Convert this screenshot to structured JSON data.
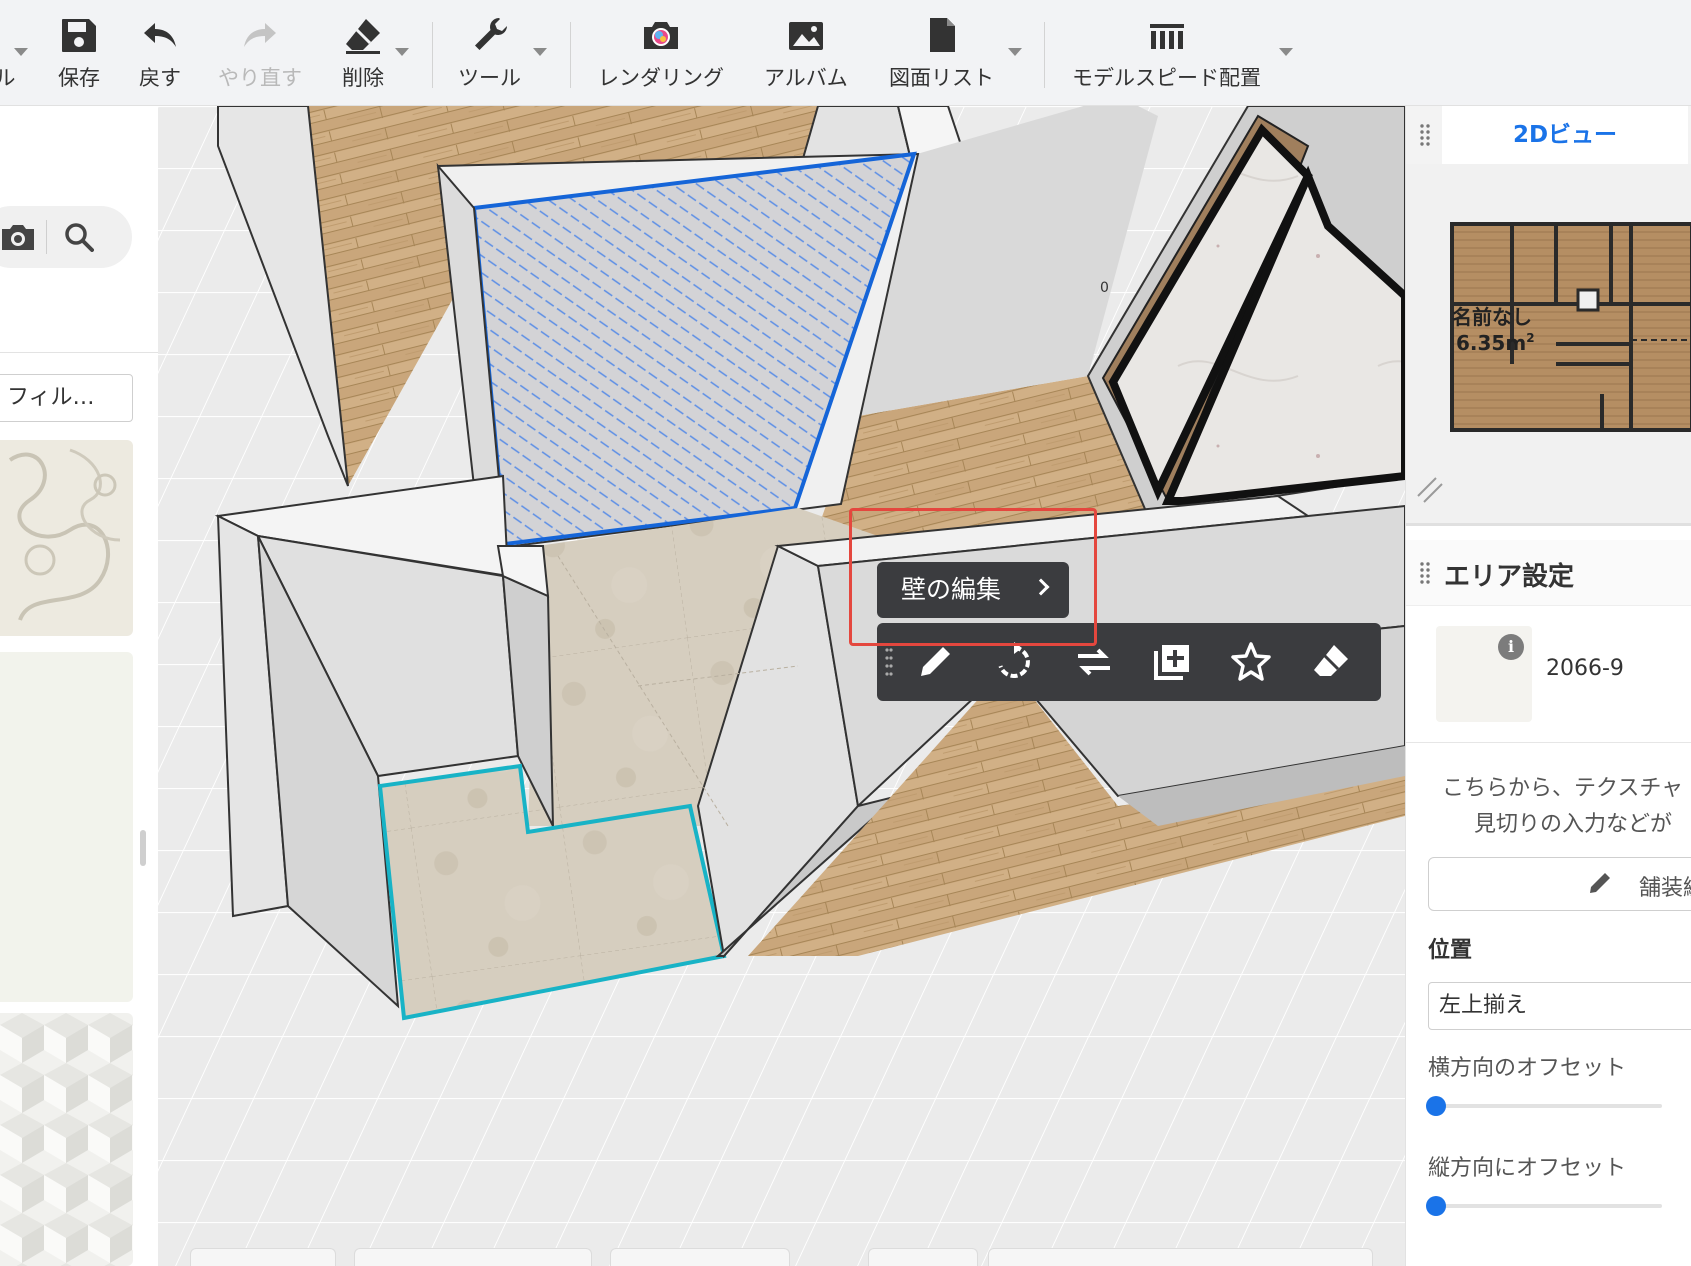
{
  "toolbar": {
    "items": [
      {
        "label": "ル",
        "icon": "file-icon"
      },
      {
        "label": "保存",
        "icon": "save-icon"
      },
      {
        "label": "戻す",
        "icon": "undo-icon"
      },
      {
        "label": "やり直す",
        "icon": "redo-icon",
        "disabled": true
      },
      {
        "label": "削除",
        "icon": "eraser-icon"
      },
      {
        "label": "ツール",
        "icon": "wrench-icon"
      },
      {
        "label": "レンダリング",
        "icon": "camera-icon"
      },
      {
        "label": "アルバム",
        "icon": "album-icon"
      },
      {
        "label": "図面リスト",
        "icon": "drawing-list-icon"
      },
      {
        "label": "モデルスピード配置",
        "icon": "model-speed-icon"
      }
    ]
  },
  "left_panel": {
    "filter_label": "フィル…",
    "icons": [
      "camera-search-icon",
      "search-icon"
    ]
  },
  "viewport": {
    "wall_edit_label": "壁の編集",
    "context_toolbar": [
      "edit-icon",
      "rotate-icon",
      "flip-icon",
      "duplicate-icon",
      "favorite-icon",
      "erase-icon"
    ]
  },
  "right_panel": {
    "tab_2d": "2Dビュー",
    "minimap": {
      "room_name": "名前なし",
      "room_area": "6.35m",
      "area_sup": "2"
    },
    "area_settings_title": "エリア設定",
    "material_code": "2066-9",
    "info_symbol": "i",
    "description_line1": "こちらから、テクスチャ",
    "description_line2": "見切りの入力などが",
    "paving_edit_label": "舗装編集",
    "position_label": "位置",
    "position_value": "左上揃え",
    "horizontal_offset_label": "横方向のオフセット",
    "vertical_offset_label": "縦方向にオフセット",
    "horizontal_offset_value": 0,
    "vertical_offset_value": 0
  },
  "colors": {
    "accent": "#1a73e8",
    "highlight": "#e4473e",
    "popup_bg": "#3b3c3f",
    "selection_blue": "#1565d8",
    "selection_cyan": "#18b3c6"
  }
}
